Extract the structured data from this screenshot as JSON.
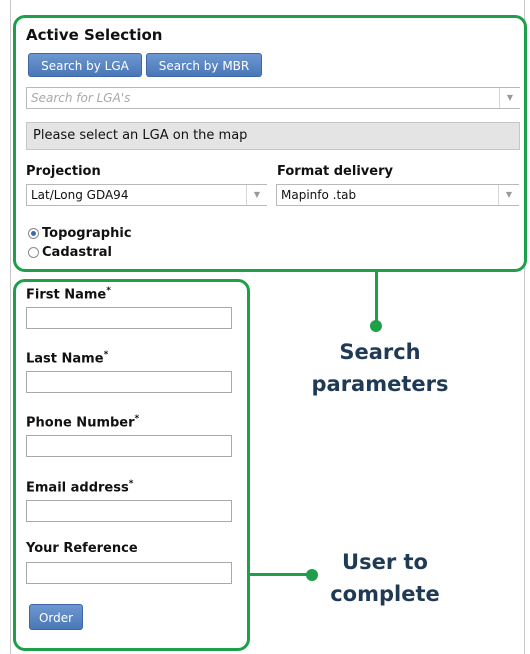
{
  "active_selection": {
    "title": "Active Selection",
    "search_by_lga_label": "Search by LGA",
    "search_by_mbr_label": "Search by MBR",
    "lga_search_placeholder": "Search for LGA's",
    "lga_search_value": "",
    "notice": "Please select an LGA on the map",
    "projection": {
      "label": "Projection",
      "selected": "Lat/Long GDA94"
    },
    "format_delivery": {
      "label": "Format delivery",
      "selected": "Mapinfo .tab"
    },
    "map_type": {
      "options": [
        {
          "label": "Topographic",
          "selected": true
        },
        {
          "label": "Cadastral",
          "selected": false
        }
      ]
    }
  },
  "user_form": {
    "fields": [
      {
        "label": "First Name",
        "required_mark": "*",
        "value": ""
      },
      {
        "label": "Last Name",
        "required_mark": "*",
        "value": ""
      },
      {
        "label": "Phone Number",
        "required_mark": "*",
        "value": ""
      },
      {
        "label": "Email address",
        "required_mark": "*",
        "value": ""
      },
      {
        "label": "Your Reference",
        "required_mark": "",
        "value": ""
      }
    ],
    "order_label": "Order"
  },
  "annotations": {
    "search_parameters": [
      "Search",
      "parameters"
    ],
    "user_to_complete": [
      "User to",
      "complete"
    ]
  },
  "colors": {
    "frame_green": "#1ea04a",
    "button_blue": "#4a77b8",
    "callout_text": "#1f3a55"
  },
  "icons": {
    "dropdown": "chevron-down-icon",
    "radio_selected": "radio-checked-icon",
    "radio_unselected": "radio-unchecked-icon"
  }
}
